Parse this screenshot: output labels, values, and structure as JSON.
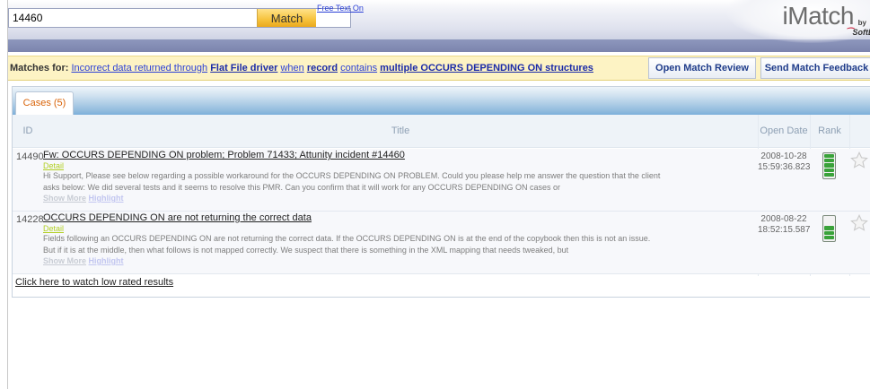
{
  "header": {
    "search_value": "14460",
    "match_label": "Match",
    "free_text_label": "Free Text On",
    "logo_text": "iMatch",
    "logo_by": "by",
    "logo_brand": "SoftLi"
  },
  "match_bar": {
    "label": "Matches for:",
    "query_parts": [
      {
        "text": "Incorrect data returned through",
        "bold": false
      },
      {
        "text": "Flat File driver",
        "bold": true
      },
      {
        "text": "when",
        "bold": false
      },
      {
        "text": "record",
        "bold": true
      },
      {
        "text": "contains",
        "bold": false
      },
      {
        "text": "multiple OCCURS DEPENDING ON structures",
        "bold": true
      }
    ],
    "open_review_label": "Open Match Review",
    "send_feedback_label": "Send Match Feedback"
  },
  "cases": {
    "tab_label": "Cases (5)",
    "columns": {
      "id": "ID",
      "title": "Title",
      "date": "Open Date",
      "rank": "Rank"
    },
    "rows": [
      {
        "id": "14490",
        "title": "Fw: OCCURS DEPENDING ON problem; Problem 71433; Attunity incident #14460",
        "detail": "Detail",
        "snippet": "Hi Support, Please see below regarding a possible workaround for the OCCURS DEPENDING ON PROBLEM. Could you please help me answer the question that the client asks below: We did several tests and it seems to resolve this PMR. Can you confirm that it will work for any OCCURS DEPENDING ON cases or",
        "show_more": "Show More",
        "highlight": "Highlight",
        "date": "2008-10-28",
        "time": "15:59:36.823",
        "rank": 5
      },
      {
        "id": "14228",
        "title": "OCCURS DEPENDING ON are not returning the correct data",
        "detail": "Detail",
        "snippet": "Fields following an OCCURS DEPENDING ON are not returning the correct data. If the OCCURS DEPENDING ON is at the end of the copybook then this is not an issue. But if it is at the middle, then what follows is not mapped correctly. We suspect that there is something in the XML mapping that needs tweaked, but",
        "show_more": "Show More",
        "highlight": "Highlight",
        "date": "2008-08-22",
        "time": "18:52:15.587",
        "rank": 3
      }
    ],
    "rank_max": 5,
    "low_rated_link": "Click here to watch low rated results"
  },
  "colors": {
    "header_stripe": "#7b84ad",
    "match_button": "#f6c23c",
    "match_bar_bg": "#fdf3c4",
    "tab_text": "#d9640a",
    "detail_link": "#b2cf25",
    "rank_fill": "#39a239"
  }
}
